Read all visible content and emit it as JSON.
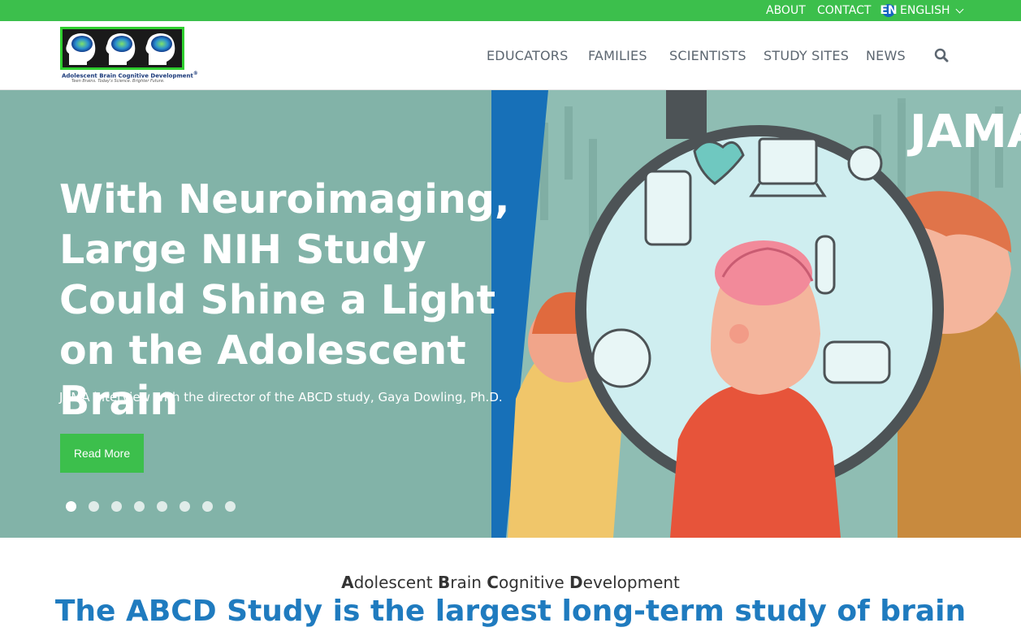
{
  "topbar": {
    "about": "ABOUT",
    "contact": "CONTACT",
    "lang_code": "EN",
    "lang_label": "ENGLISH"
  },
  "logo": {
    "text": "Adolescent Brain Cognitive Development",
    "reg": "®",
    "tagline": "Teen Brains. Today's Science. Brighter Future."
  },
  "nav": {
    "items": [
      "EDUCATORS",
      "FAMILIES",
      "SCIENTISTS",
      "STUDY SITES",
      "NEWS"
    ]
  },
  "hero": {
    "title": "With Neuroimaging, Large NIH Study Could Shine a Light on the Adolescent Brain",
    "subtitle": "JAMA interview with the director of the ABCD study, Gaya Dowling, Ph.D.",
    "button": "Read More",
    "art_text": "JAMA",
    "slide_count": 8,
    "active_slide": 1
  },
  "intro": {
    "kicker": [
      "A",
      "dolescent ",
      "B",
      "rain ",
      "C",
      "ognitive ",
      "D",
      "evelopment"
    ],
    "headline": "The ABCD Study is the largest long-term study of brain"
  },
  "colors": {
    "green": "#3cbf4c",
    "hero_bg": "#82b3a8",
    "headline_blue": "#1f7bbf"
  }
}
